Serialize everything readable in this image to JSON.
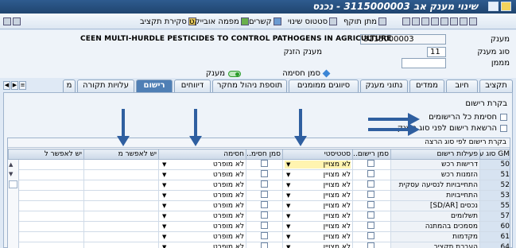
{
  "window": {
    "title": "שינוי מענק אב 3115000003 - נכנס"
  },
  "toolbar": {
    "items": [
      {
        "label": "סקירת תקציב",
        "icon": "budget-overview-icon"
      },
      {
        "label": "מפמה אובייקט",
        "icon": "object-map-icon"
      },
      {
        "label": "קשרים",
        "icon": "relations-icon"
      },
      {
        "label": "סטטוס שינוי",
        "icon": "change-status-icon"
      },
      {
        "label": "מתן תוקף",
        "icon": "validate-icon"
      }
    ]
  },
  "header": {
    "grant_label": "מענק",
    "grant_value": "3115000003",
    "grant_desc": "CEEN MULTI-HURDLE PESTICIDES TO CONTROL PATHOGENS IN AGRICULTURE",
    "grant_type_label": "סוג מענק",
    "grant_type_value": "11",
    "grant_type_desc": "מענק הזנק",
    "funder_label": "מממן",
    "funder_value": "",
    "legend_blocked": "סמן חסימה",
    "legend_grant": "מענק"
  },
  "tabs": [
    {
      "label": "תקציב"
    },
    {
      "label": "חיוב"
    },
    {
      "label": "ממדים"
    },
    {
      "label": "נתוני מענק"
    },
    {
      "label": "סיווגים ממומנים"
    },
    {
      "label": "תוספת ניהול מחקר"
    },
    {
      "label": "דיווחים"
    },
    {
      "label": "רישום",
      "active": true
    },
    {
      "label": "עלויות תקורה"
    },
    {
      "label": "מ"
    }
  ],
  "posting_control": {
    "section_title": "בקרת רישום",
    "block_all_label": "חסימת כל הרישומים",
    "allow_by_type_label": "הרשאת רישום לפני סוג מענק",
    "grid_caption": "בקרת רישום לפי סוג הרצה",
    "columns": [
      "GM סוג ערך",
      "פעילות רישום",
      "סמן רישום...",
      "סטטיסטי",
      "סמן חסימ...",
      "חסימה",
      "יש לאפשר מ",
      "יש לאפשר ל"
    ],
    "rows": [
      {
        "num": "50",
        "activity": "דרישות רכש",
        "stat": "לא מצויין",
        "block": "לא מופרט"
      },
      {
        "num": "51",
        "activity": "הזמנות רכש",
        "stat": "לא מצויין",
        "block": "לא מופרט"
      },
      {
        "num": "52",
        "activity": "התחייבויות לנסיעה עסקית",
        "stat": "לא מצויין",
        "block": "לא מופרט"
      },
      {
        "num": "53",
        "activity": "התחייבויות",
        "stat": "לא מצויין",
        "block": "לא מופרט"
      },
      {
        "num": "55",
        "activity": "נכסים [SD/AR]",
        "stat": "לא מצויין",
        "block": "לא מופרט"
      },
      {
        "num": "57",
        "activity": "תשלומים",
        "stat": "לא מצויין",
        "block": "לא מופרט"
      },
      {
        "num": "60",
        "activity": "מסמכים בהמתנה",
        "stat": "לא מצויין",
        "block": "לא מופרט"
      },
      {
        "num": "61",
        "activity": "מקדמות",
        "stat": "לא מצויין",
        "block": "לא מופרט"
      },
      {
        "num": "64",
        "activity": "העברת תקציב",
        "stat": "לא מצויין",
        "block": "לא מופרט"
      }
    ]
  },
  "colors": {
    "title_bar": "#2e5b8f",
    "active_tab": "#4f7fb5",
    "annotation_arrow": "#2f5fa0",
    "highlight_cell": "#fff4b0"
  }
}
